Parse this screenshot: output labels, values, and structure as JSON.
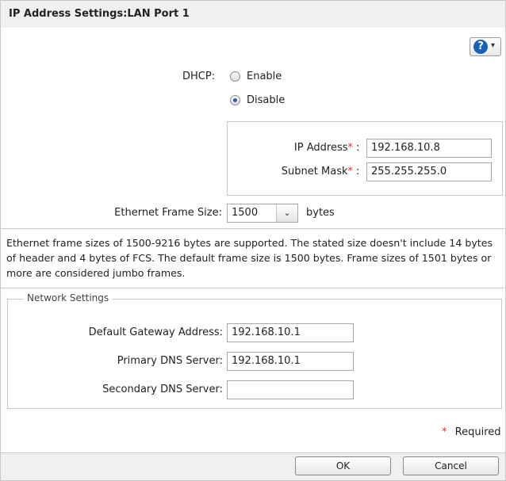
{
  "title": "IP Address Settings:LAN Port 1",
  "help": {
    "icon": "question-icon",
    "symbol": "?",
    "caret": "▾"
  },
  "dhcp": {
    "label": "DHCP:",
    "options": [
      {
        "label": "Enable",
        "selected": false
      },
      {
        "label": "Disable",
        "selected": true
      }
    ]
  },
  "ip": {
    "ip_label": "IP Address",
    "ip_value": "192.168.10.8",
    "mask_label": "Subnet Mask",
    "mask_value": "255.255.255.0",
    "asterisk": "*",
    "colon": ":"
  },
  "frame": {
    "label": "Ethernet Frame Size:",
    "value": "1500",
    "unit": "bytes"
  },
  "description": "Ethernet frame sizes of 1500-9216 bytes are supported. The stated size doesn't include 14 bytes of header and 4 bytes of FCS. The default frame size is 1500 bytes. Frame sizes of 1501 bytes or more are considered jumbo frames.",
  "network": {
    "legend": "Network Settings",
    "gateway_label": "Default Gateway Address:",
    "gateway_value": "192.168.10.1",
    "primary_dns_label": "Primary DNS Server:",
    "primary_dns_value": "192.168.10.1",
    "secondary_dns_label": "Secondary DNS Server:",
    "secondary_dns_value": ""
  },
  "required_note": {
    "asterisk": "*",
    "text": "Required"
  },
  "buttons": {
    "ok": "OK",
    "cancel": "Cancel"
  },
  "colors": {
    "required": "#e03030",
    "help_blue": "#1a5fb4"
  }
}
